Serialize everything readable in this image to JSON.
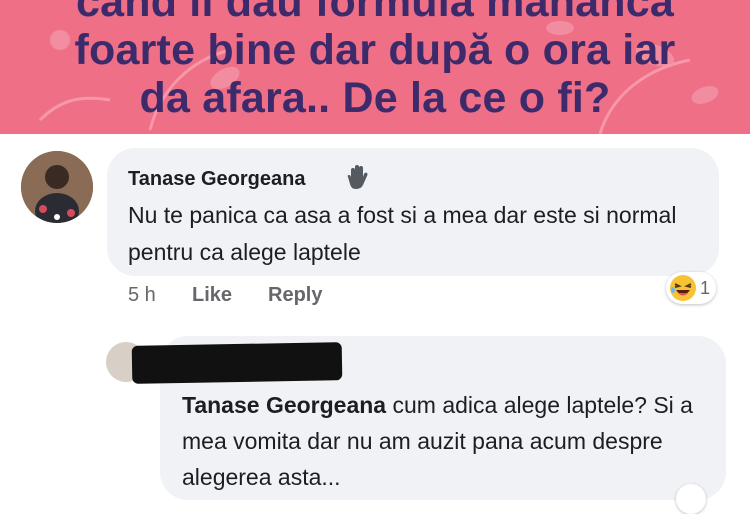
{
  "banner": {
    "line1": "cand ii dau formula mananca",
    "line2": "foarte bine dar după o ora iar",
    "line3": "da afara.. De la ce o fi?"
  },
  "comment": {
    "author": "Tanase Georgeana",
    "author_badge_icon": "waving-hand-icon",
    "text": "Nu te panica ca asa a fost si a mea dar este si normal pentru ca alege laptele",
    "time": "5 h",
    "like_label": "Like",
    "reply_label": "Reply",
    "reaction_icon": "laughing-emoji-icon",
    "reaction_count": "1"
  },
  "reply": {
    "author": "[redacted]",
    "mention": "Tanase Georgeana",
    "text": " cum adica alege laptele? Si a mea vomita dar nu am auzit pana acum despre alegerea asta..."
  },
  "colors": {
    "banner_bg": "#ee6f86",
    "banner_text": "#3d2a6b",
    "bubble_bg": "#f0f2f5",
    "meta_text": "#65676b"
  }
}
